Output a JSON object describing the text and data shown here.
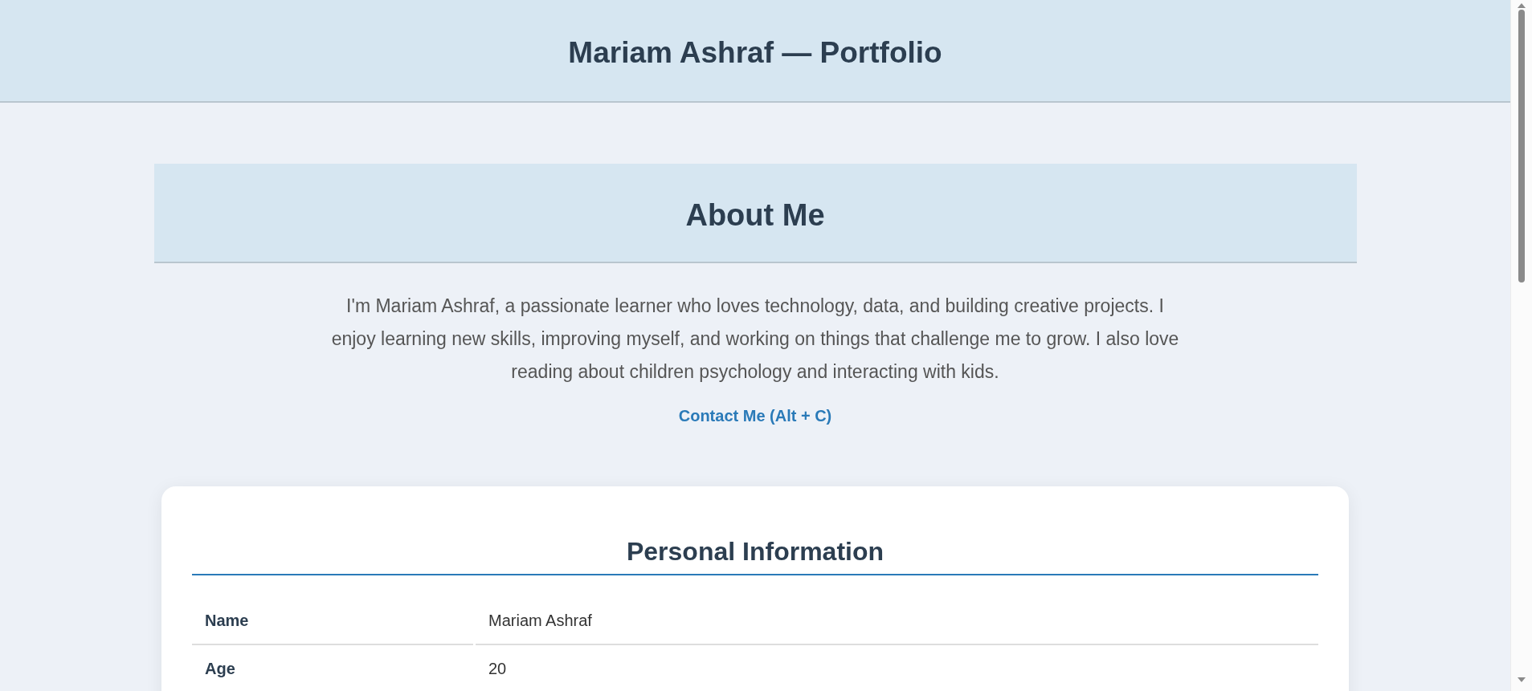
{
  "header": {
    "title": "Mariam Ashraf — Portfolio"
  },
  "about": {
    "heading": "About Me",
    "paragraph": "I'm Mariam Ashraf, a passionate learner who loves technology, data, and building creative projects. I enjoy learning new skills, improving myself, and working on things that challenge me to grow. I also love reading about children psychology and interacting with kids.",
    "contact_link": "Contact Me (Alt + C)"
  },
  "personal_info": {
    "heading": "Personal Information",
    "rows": [
      {
        "label": "Name",
        "value": "Mariam Ashraf"
      },
      {
        "label": "Age",
        "value": "20"
      }
    ]
  }
}
